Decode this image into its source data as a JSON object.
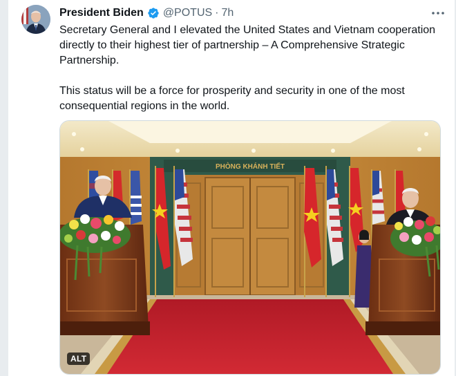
{
  "tweet": {
    "author_name": "President Biden",
    "handle": "@POTUS",
    "separator": "·",
    "time": "7h",
    "paragraphs": [
      "Secretary General and I elevated the United States and Vietnam cooperation directly to their highest tier of partnership – A Comprehensive Strategic Partnership.",
      "This status will be a force for prosperity and security in one of the most consequential regions in the world."
    ]
  },
  "media": {
    "alt_badge": "ALT",
    "room_sign": "PHÒNG KHÁNH TIẾT"
  },
  "icons": {
    "verified": "verified-badge-icon",
    "more": "more-options-icon"
  },
  "colors": {
    "verified_blue": "#1d9bf0",
    "text_primary": "#0f1419",
    "text_secondary": "#536471"
  }
}
